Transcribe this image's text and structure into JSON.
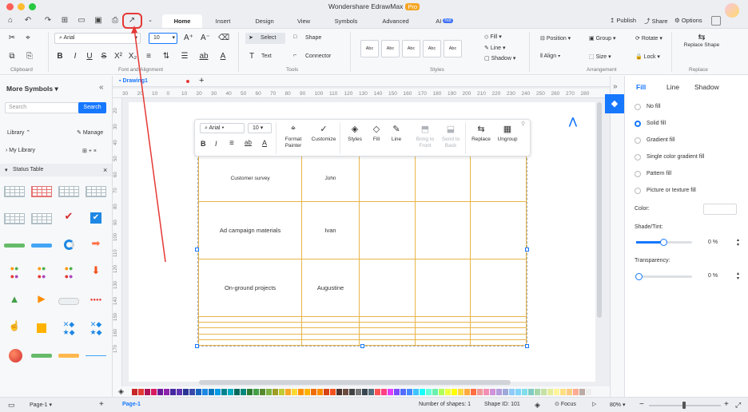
{
  "window": {
    "title": "Wondershare EdrawMax",
    "badge": "Pro"
  },
  "tabs": [
    {
      "label": "Home"
    },
    {
      "label": "Insert"
    },
    {
      "label": "Design"
    },
    {
      "label": "View"
    },
    {
      "label": "Symbols"
    },
    {
      "label": "Advanced"
    },
    {
      "label": "AI",
      "badge": "hot"
    }
  ],
  "titlebar_right": {
    "publish": "Publish",
    "share": "Share",
    "options": "Options"
  },
  "ribbon": {
    "clipboard": "Clipboard",
    "font_and_alignment": "Font and Alignment",
    "font": "Arial",
    "font_size": "10",
    "select": "Select",
    "shape": "Shape",
    "text": "Text",
    "connector": "Connector",
    "tools": "Tools",
    "style_sample": "Abc",
    "styles": "Styles",
    "fill": "Fill",
    "line": "Line",
    "shadow": "Shadow",
    "position": "Position",
    "group": "Group",
    "rotate": "Rotate",
    "align": "Align",
    "size": "Size",
    "lock": "Lock",
    "replace_shape": "Replace Shape",
    "arrangement": "Arrangement",
    "replace": "Replace"
  },
  "left_panel": {
    "title": "More Symbols",
    "search_placeholder": "Search",
    "search_button": "Search",
    "library": "Library",
    "manage": "Manage",
    "my_library": "My Library",
    "status_table": "Status Table"
  },
  "doc_tab": "Drawing1",
  "ruler": {
    "h": [
      "30",
      "20",
      "10",
      "0",
      "10",
      "20",
      "30",
      "40",
      "50",
      "60",
      "70",
      "80",
      "90",
      "100",
      "110",
      "120",
      "130",
      "140",
      "150",
      "160",
      "170",
      "180",
      "190",
      "200",
      "210",
      "220",
      "230",
      "240",
      "250",
      "260",
      "270",
      "280"
    ],
    "v": [
      "20",
      "30",
      "40",
      "50",
      "60",
      "70",
      "80",
      "90",
      "100",
      "110",
      "120",
      "130",
      "140",
      "150",
      "160",
      "170"
    ]
  },
  "floating_toolbar": {
    "font": "Arial",
    "size": "10",
    "format_painter": "Format Painter",
    "customize": "Customize",
    "styles": "Styles",
    "fill": "Fill",
    "line": "Line",
    "bring_to_front": "Bring to Front",
    "send_to_back": "Send to Back",
    "replace": "Replace",
    "ungroup": "Ungroup"
  },
  "table": {
    "rows": [
      [
        "Customer survey",
        "John"
      ],
      [
        "Ad campaign materials",
        "Ivan"
      ],
      [
        "On-ground projects",
        "Augustine"
      ],
      [
        "",
        ""
      ],
      [
        "",
        ""
      ],
      [
        "",
        ""
      ],
      [
        "",
        ""
      ],
      [
        "",
        ""
      ]
    ]
  },
  "right_panel": {
    "tabs": [
      "Fill",
      "Line",
      "Shadow"
    ],
    "options": [
      "No fill",
      "Solid fill",
      "Gradient fill",
      "Single color gradient fill",
      "Pattern fill",
      "Picture or texture fill"
    ],
    "selected": "Solid fill",
    "color_label": "Color:",
    "shade_label": "Shade/Tint:",
    "shade_value": "0 %",
    "transparency_label": "Transparency:",
    "transparency_value": "0 %"
  },
  "status": {
    "page_label": "Page-1",
    "page_tab": "Page-1",
    "shapes": "Number of shapes: 1",
    "shape_id": "Shape ID: 101",
    "focus": "Focus",
    "zoom": "80%"
  },
  "colors": {
    "accent": "#1677ff",
    "annotation": "#e53935",
    "table_border": "#e8b54a"
  }
}
